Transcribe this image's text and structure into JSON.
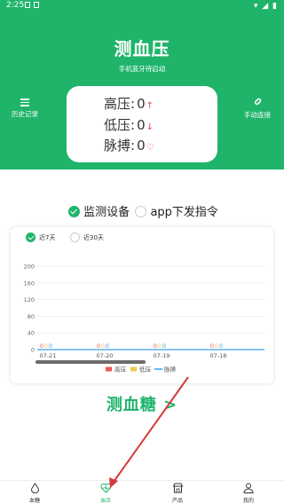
{
  "status_bar": {
    "time": "2:25"
  },
  "header": {
    "title": "测血压",
    "subtitle": "手机蓝牙待启动",
    "history_label": "历史记录",
    "connect_label": "手动连接"
  },
  "readings": {
    "systolic_label": "高压:",
    "systolic_value": "0",
    "diastolic_label": "低压:",
    "diastolic_value": "0",
    "pulse_label": "脉搏:",
    "pulse_value": "0"
  },
  "modes": {
    "device_label": "监测设备",
    "app_label": "app下发指令",
    "selected": "device"
  },
  "periods": {
    "seven_label": "近7天",
    "thirty_label": "近30天",
    "selected": "seven"
  },
  "chart_data": {
    "type": "bar",
    "categories": [
      "07-21",
      "07-20",
      "07-19",
      "07-18"
    ],
    "y_ticks": [
      0,
      40,
      80,
      120,
      160,
      200
    ],
    "ylim": [
      0,
      200
    ],
    "series": [
      {
        "name": "高压",
        "values": [
          0,
          0,
          0,
          0
        ],
        "color": "#e8575a"
      },
      {
        "name": "低压",
        "values": [
          0,
          0,
          0,
          0
        ],
        "color": "#f2c94c"
      },
      {
        "name": "脉搏",
        "values": [
          0,
          0,
          0,
          0
        ],
        "color": "#3a9ee8"
      }
    ],
    "legend_position": "bottom",
    "grid": true
  },
  "glucose_link": "测血糖 >",
  "nav": {
    "items": [
      {
        "label": "血糖",
        "icon": "glucose-drop-icon"
      },
      {
        "label": "血压",
        "icon": "heart-pulse-icon"
      },
      {
        "label": "产品",
        "icon": "shop-icon"
      },
      {
        "label": "我的",
        "icon": "user-icon"
      }
    ],
    "active": 1
  },
  "colors": {
    "accent": "#1fb46a",
    "alert": "#e04545"
  }
}
